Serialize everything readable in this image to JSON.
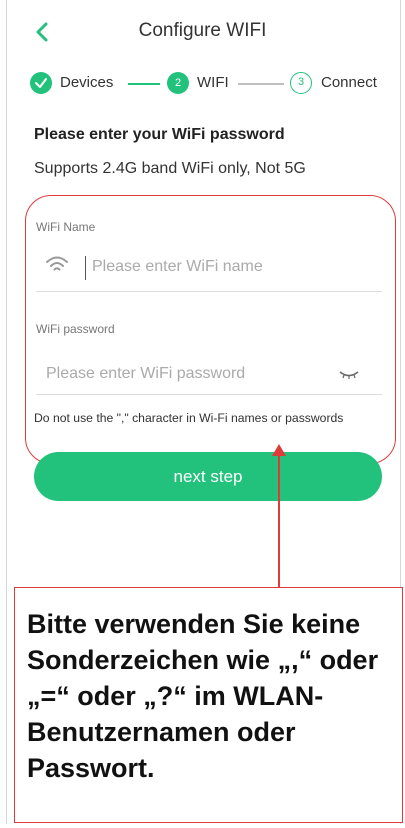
{
  "header": {
    "title": "Configure WIFI"
  },
  "steps": [
    {
      "label": "Devices",
      "number": ""
    },
    {
      "label": "WIFI",
      "number": "2"
    },
    {
      "label": "Connect",
      "number": "3"
    }
  ],
  "intro": {
    "heading": "Please enter your WiFi password",
    "subheading": "Supports 2.4G band WiFi only, Not 5G"
  },
  "form": {
    "name_label": "WiFi Name",
    "name_placeholder": "Please enter WiFi name",
    "password_label": "WiFi password",
    "password_placeholder": "Please enter WiFi password",
    "notice": "Do not use the \",\" character in Wi-Fi names or passwords"
  },
  "next_label": "next step",
  "callout": {
    "text": "Bitte verwenden Sie keine Sonderzeichen wie „,“ oder „=“ oder „?“ im WLAN-Benutzernamen oder Passwort."
  },
  "colors": {
    "accent": "#22c27d",
    "annotation": "#e03a3a"
  }
}
